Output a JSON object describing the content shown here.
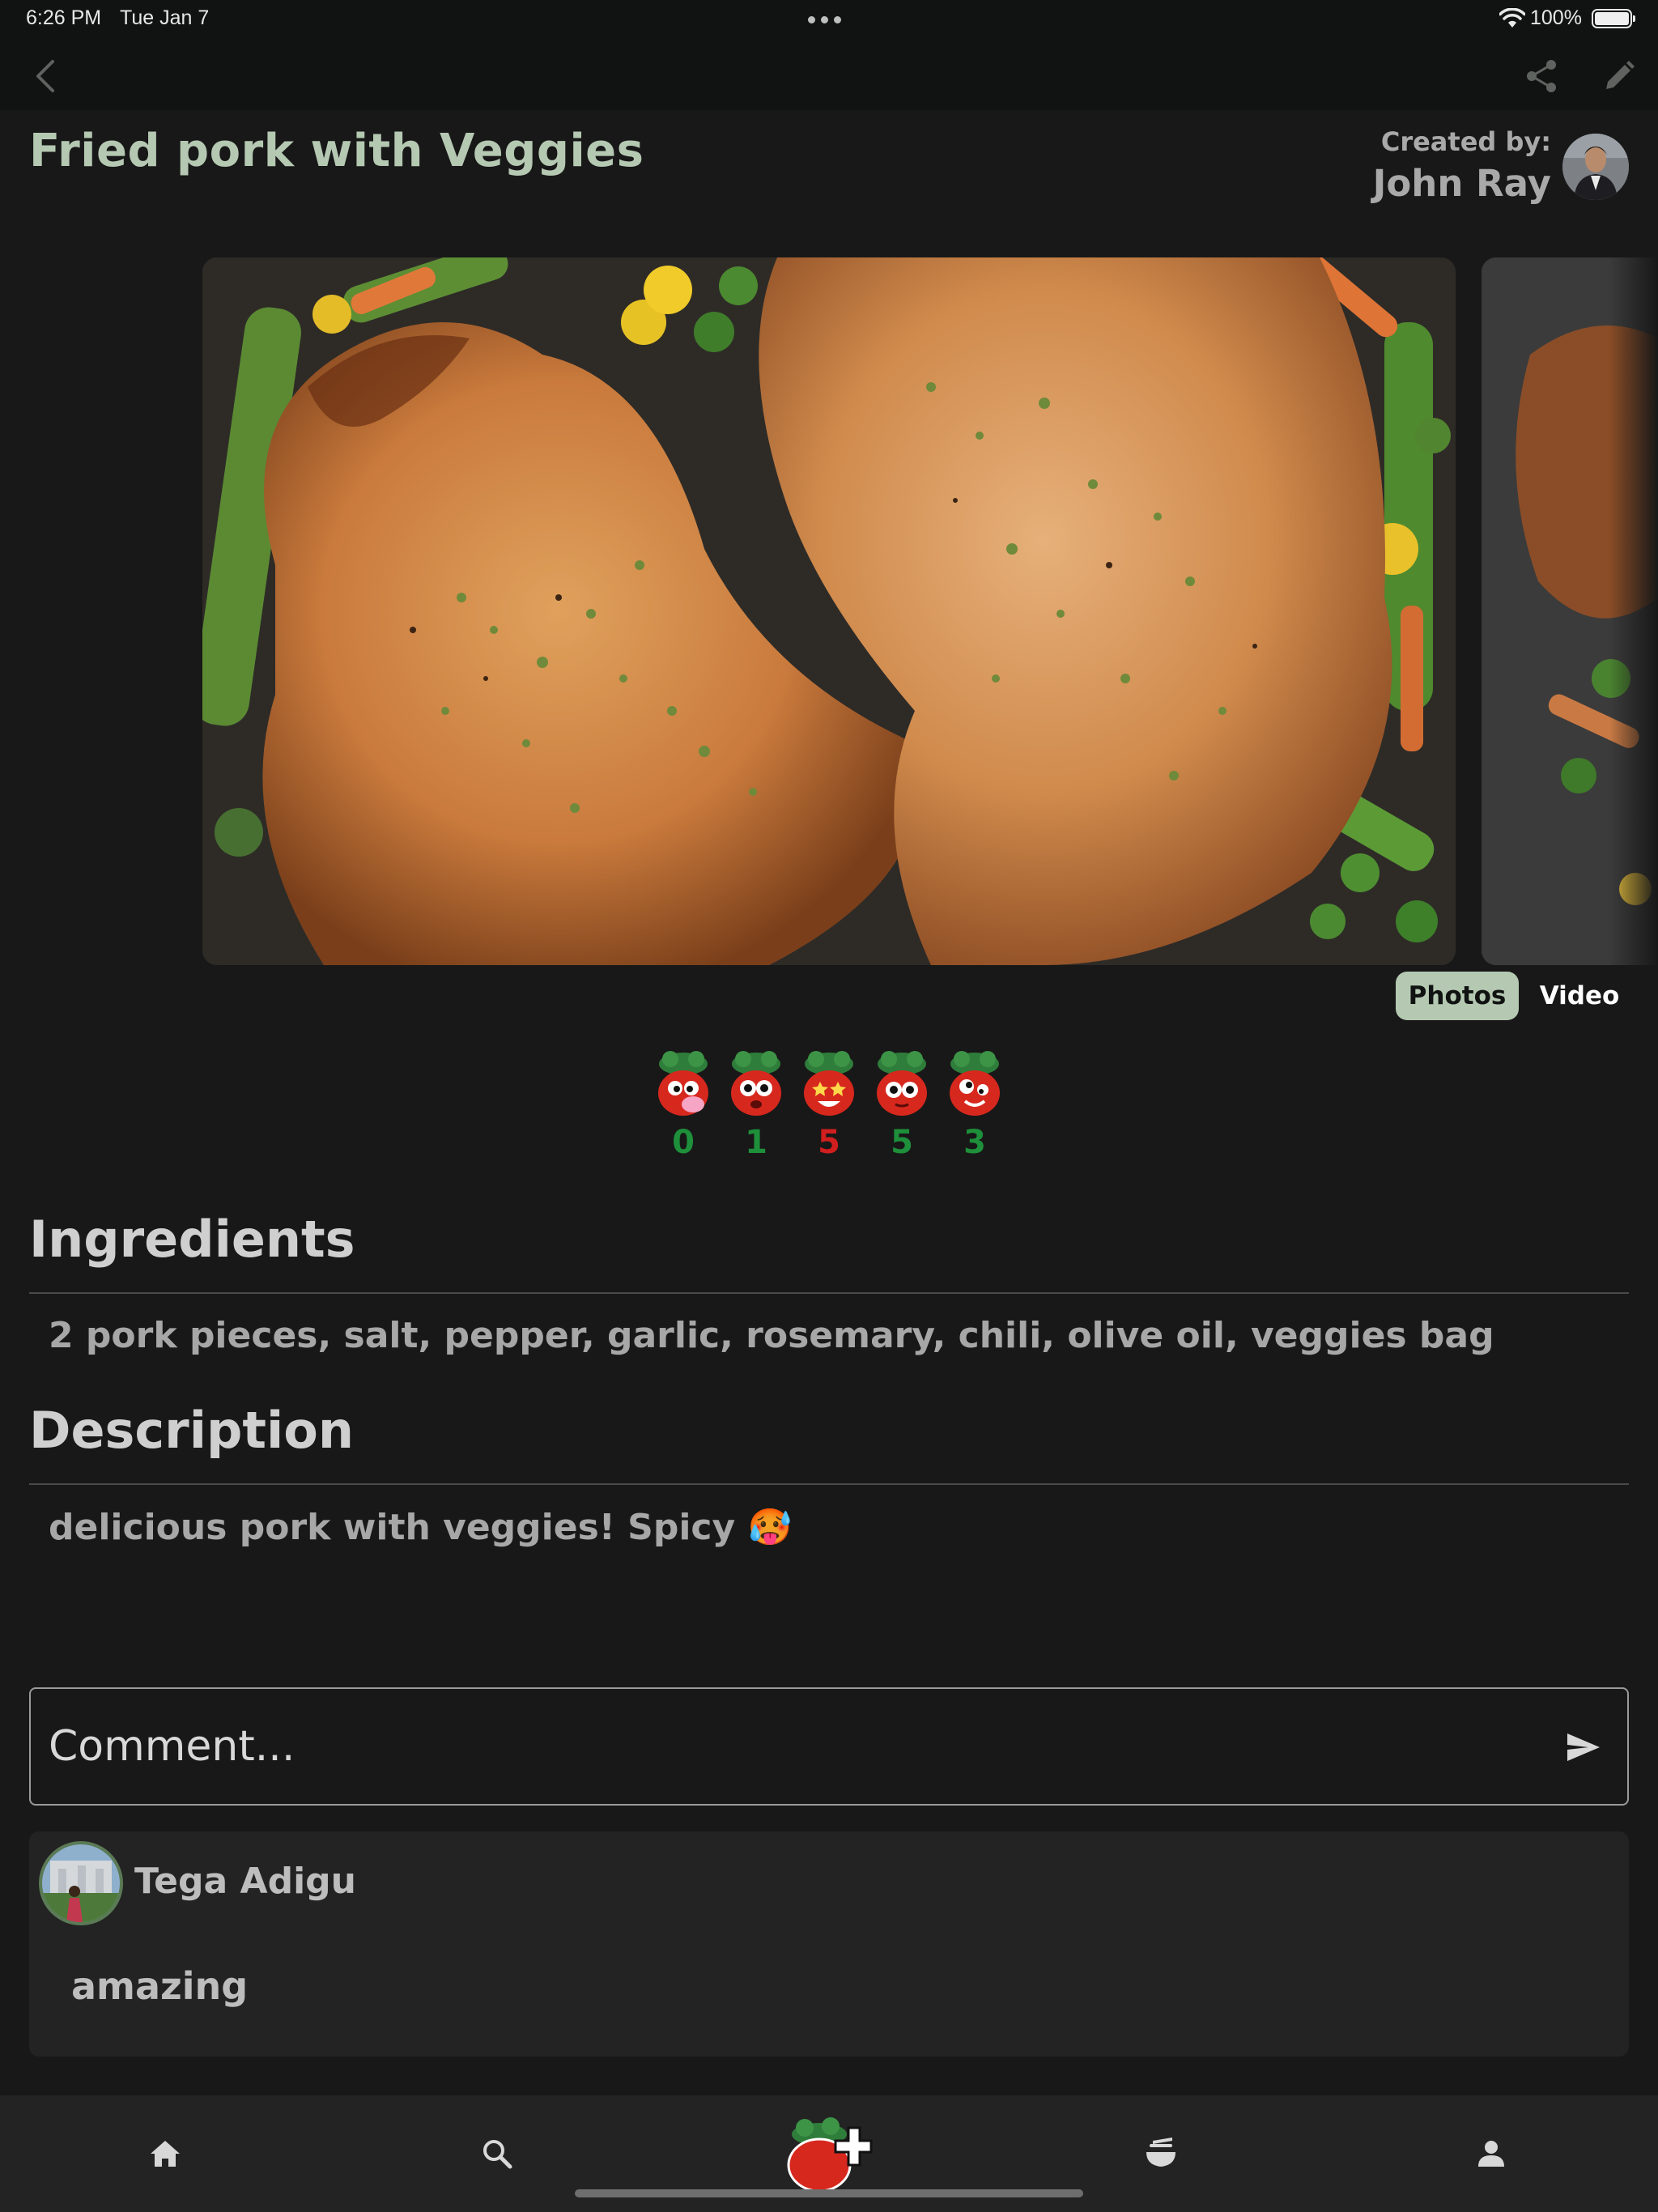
{
  "status_bar": {
    "time": "6:26 PM",
    "date": "Tue Jan 7",
    "battery": "100%",
    "icons": [
      "wifi-icon",
      "battery-icon",
      "multitasking-dots-icon"
    ]
  },
  "nav": {
    "icons": [
      "chevron-left-icon",
      "share-icon",
      "pencil-icon"
    ]
  },
  "recipe": {
    "title": "Fried pork with Veggies",
    "created_by_label": "Created by:",
    "author": "John Ray"
  },
  "gallery": {
    "toggle": {
      "photos": "Photos",
      "video": "Video",
      "selected": "Photos"
    }
  },
  "reactions": [
    {
      "name": "tomato-cheeky",
      "count": "0",
      "color": "#1e8f3a"
    },
    {
      "name": "tomato-surprised",
      "count": "1",
      "color": "#1e8f3a"
    },
    {
      "name": "tomato-star-eyes",
      "count": "5",
      "color": "#d11f1f"
    },
    {
      "name": "tomato-wide-eyes",
      "count": "5",
      "color": "#1e8f3a"
    },
    {
      "name": "tomato-goofy",
      "count": "3",
      "color": "#1e8f3a"
    }
  ],
  "ingredients": {
    "heading": "Ingredients",
    "text": "2 pork pieces, salt, pepper, garlic, rosemary, chili, olive oil, veggies bag"
  },
  "description": {
    "heading": "Description",
    "text": "delicious pork with veggies! Spicy 🥵"
  },
  "comment_input": {
    "placeholder": "Comment..."
  },
  "comments": [
    {
      "author": "Tega Adigu",
      "text": "amazing"
    }
  ],
  "tab_bar": {
    "icons": [
      "home-icon",
      "search-icon",
      "add-recipe-icon",
      "recipes-icon",
      "profile-icon"
    ]
  },
  "colors": {
    "accent": "#b5c9b2",
    "background": "#181818",
    "bar": "#101311",
    "count_green": "#1e8f3a",
    "count_red": "#d11f1f"
  }
}
